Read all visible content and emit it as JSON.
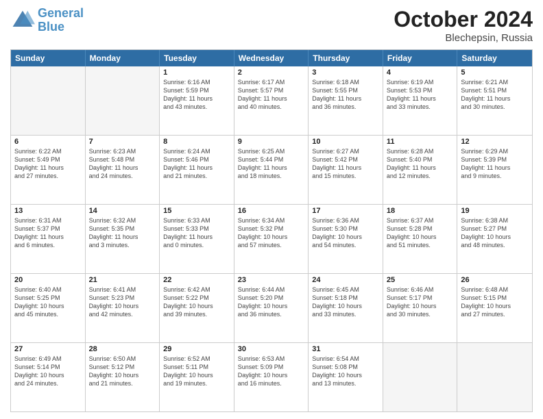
{
  "header": {
    "logo_line1": "General",
    "logo_line2": "Blue",
    "month": "October 2024",
    "location": "Blechepsin, Russia"
  },
  "weekdays": [
    "Sunday",
    "Monday",
    "Tuesday",
    "Wednesday",
    "Thursday",
    "Friday",
    "Saturday"
  ],
  "rows": [
    [
      {
        "day": "",
        "lines": [],
        "empty": true
      },
      {
        "day": "",
        "lines": [],
        "empty": true
      },
      {
        "day": "1",
        "lines": [
          "Sunrise: 6:16 AM",
          "Sunset: 5:59 PM",
          "Daylight: 11 hours",
          "and 43 minutes."
        ]
      },
      {
        "day": "2",
        "lines": [
          "Sunrise: 6:17 AM",
          "Sunset: 5:57 PM",
          "Daylight: 11 hours",
          "and 40 minutes."
        ]
      },
      {
        "day": "3",
        "lines": [
          "Sunrise: 6:18 AM",
          "Sunset: 5:55 PM",
          "Daylight: 11 hours",
          "and 36 minutes."
        ]
      },
      {
        "day": "4",
        "lines": [
          "Sunrise: 6:19 AM",
          "Sunset: 5:53 PM",
          "Daylight: 11 hours",
          "and 33 minutes."
        ]
      },
      {
        "day": "5",
        "lines": [
          "Sunrise: 6:21 AM",
          "Sunset: 5:51 PM",
          "Daylight: 11 hours",
          "and 30 minutes."
        ]
      }
    ],
    [
      {
        "day": "6",
        "lines": [
          "Sunrise: 6:22 AM",
          "Sunset: 5:49 PM",
          "Daylight: 11 hours",
          "and 27 minutes."
        ]
      },
      {
        "day": "7",
        "lines": [
          "Sunrise: 6:23 AM",
          "Sunset: 5:48 PM",
          "Daylight: 11 hours",
          "and 24 minutes."
        ]
      },
      {
        "day": "8",
        "lines": [
          "Sunrise: 6:24 AM",
          "Sunset: 5:46 PM",
          "Daylight: 11 hours",
          "and 21 minutes."
        ]
      },
      {
        "day": "9",
        "lines": [
          "Sunrise: 6:25 AM",
          "Sunset: 5:44 PM",
          "Daylight: 11 hours",
          "and 18 minutes."
        ]
      },
      {
        "day": "10",
        "lines": [
          "Sunrise: 6:27 AM",
          "Sunset: 5:42 PM",
          "Daylight: 11 hours",
          "and 15 minutes."
        ]
      },
      {
        "day": "11",
        "lines": [
          "Sunrise: 6:28 AM",
          "Sunset: 5:40 PM",
          "Daylight: 11 hours",
          "and 12 minutes."
        ]
      },
      {
        "day": "12",
        "lines": [
          "Sunrise: 6:29 AM",
          "Sunset: 5:39 PM",
          "Daylight: 11 hours",
          "and 9 minutes."
        ]
      }
    ],
    [
      {
        "day": "13",
        "lines": [
          "Sunrise: 6:31 AM",
          "Sunset: 5:37 PM",
          "Daylight: 11 hours",
          "and 6 minutes."
        ]
      },
      {
        "day": "14",
        "lines": [
          "Sunrise: 6:32 AM",
          "Sunset: 5:35 PM",
          "Daylight: 11 hours",
          "and 3 minutes."
        ]
      },
      {
        "day": "15",
        "lines": [
          "Sunrise: 6:33 AM",
          "Sunset: 5:33 PM",
          "Daylight: 11 hours",
          "and 0 minutes."
        ]
      },
      {
        "day": "16",
        "lines": [
          "Sunrise: 6:34 AM",
          "Sunset: 5:32 PM",
          "Daylight: 10 hours",
          "and 57 minutes."
        ]
      },
      {
        "day": "17",
        "lines": [
          "Sunrise: 6:36 AM",
          "Sunset: 5:30 PM",
          "Daylight: 10 hours",
          "and 54 minutes."
        ]
      },
      {
        "day": "18",
        "lines": [
          "Sunrise: 6:37 AM",
          "Sunset: 5:28 PM",
          "Daylight: 10 hours",
          "and 51 minutes."
        ]
      },
      {
        "day": "19",
        "lines": [
          "Sunrise: 6:38 AM",
          "Sunset: 5:27 PM",
          "Daylight: 10 hours",
          "and 48 minutes."
        ]
      }
    ],
    [
      {
        "day": "20",
        "lines": [
          "Sunrise: 6:40 AM",
          "Sunset: 5:25 PM",
          "Daylight: 10 hours",
          "and 45 minutes."
        ]
      },
      {
        "day": "21",
        "lines": [
          "Sunrise: 6:41 AM",
          "Sunset: 5:23 PM",
          "Daylight: 10 hours",
          "and 42 minutes."
        ]
      },
      {
        "day": "22",
        "lines": [
          "Sunrise: 6:42 AM",
          "Sunset: 5:22 PM",
          "Daylight: 10 hours",
          "and 39 minutes."
        ]
      },
      {
        "day": "23",
        "lines": [
          "Sunrise: 6:44 AM",
          "Sunset: 5:20 PM",
          "Daylight: 10 hours",
          "and 36 minutes."
        ]
      },
      {
        "day": "24",
        "lines": [
          "Sunrise: 6:45 AM",
          "Sunset: 5:18 PM",
          "Daylight: 10 hours",
          "and 33 minutes."
        ]
      },
      {
        "day": "25",
        "lines": [
          "Sunrise: 6:46 AM",
          "Sunset: 5:17 PM",
          "Daylight: 10 hours",
          "and 30 minutes."
        ]
      },
      {
        "day": "26",
        "lines": [
          "Sunrise: 6:48 AM",
          "Sunset: 5:15 PM",
          "Daylight: 10 hours",
          "and 27 minutes."
        ]
      }
    ],
    [
      {
        "day": "27",
        "lines": [
          "Sunrise: 6:49 AM",
          "Sunset: 5:14 PM",
          "Daylight: 10 hours",
          "and 24 minutes."
        ]
      },
      {
        "day": "28",
        "lines": [
          "Sunrise: 6:50 AM",
          "Sunset: 5:12 PM",
          "Daylight: 10 hours",
          "and 21 minutes."
        ]
      },
      {
        "day": "29",
        "lines": [
          "Sunrise: 6:52 AM",
          "Sunset: 5:11 PM",
          "Daylight: 10 hours",
          "and 19 minutes."
        ]
      },
      {
        "day": "30",
        "lines": [
          "Sunrise: 6:53 AM",
          "Sunset: 5:09 PM",
          "Daylight: 10 hours",
          "and 16 minutes."
        ]
      },
      {
        "day": "31",
        "lines": [
          "Sunrise: 6:54 AM",
          "Sunset: 5:08 PM",
          "Daylight: 10 hours",
          "and 13 minutes."
        ]
      },
      {
        "day": "",
        "lines": [],
        "empty": true
      },
      {
        "day": "",
        "lines": [],
        "empty": true
      }
    ]
  ]
}
